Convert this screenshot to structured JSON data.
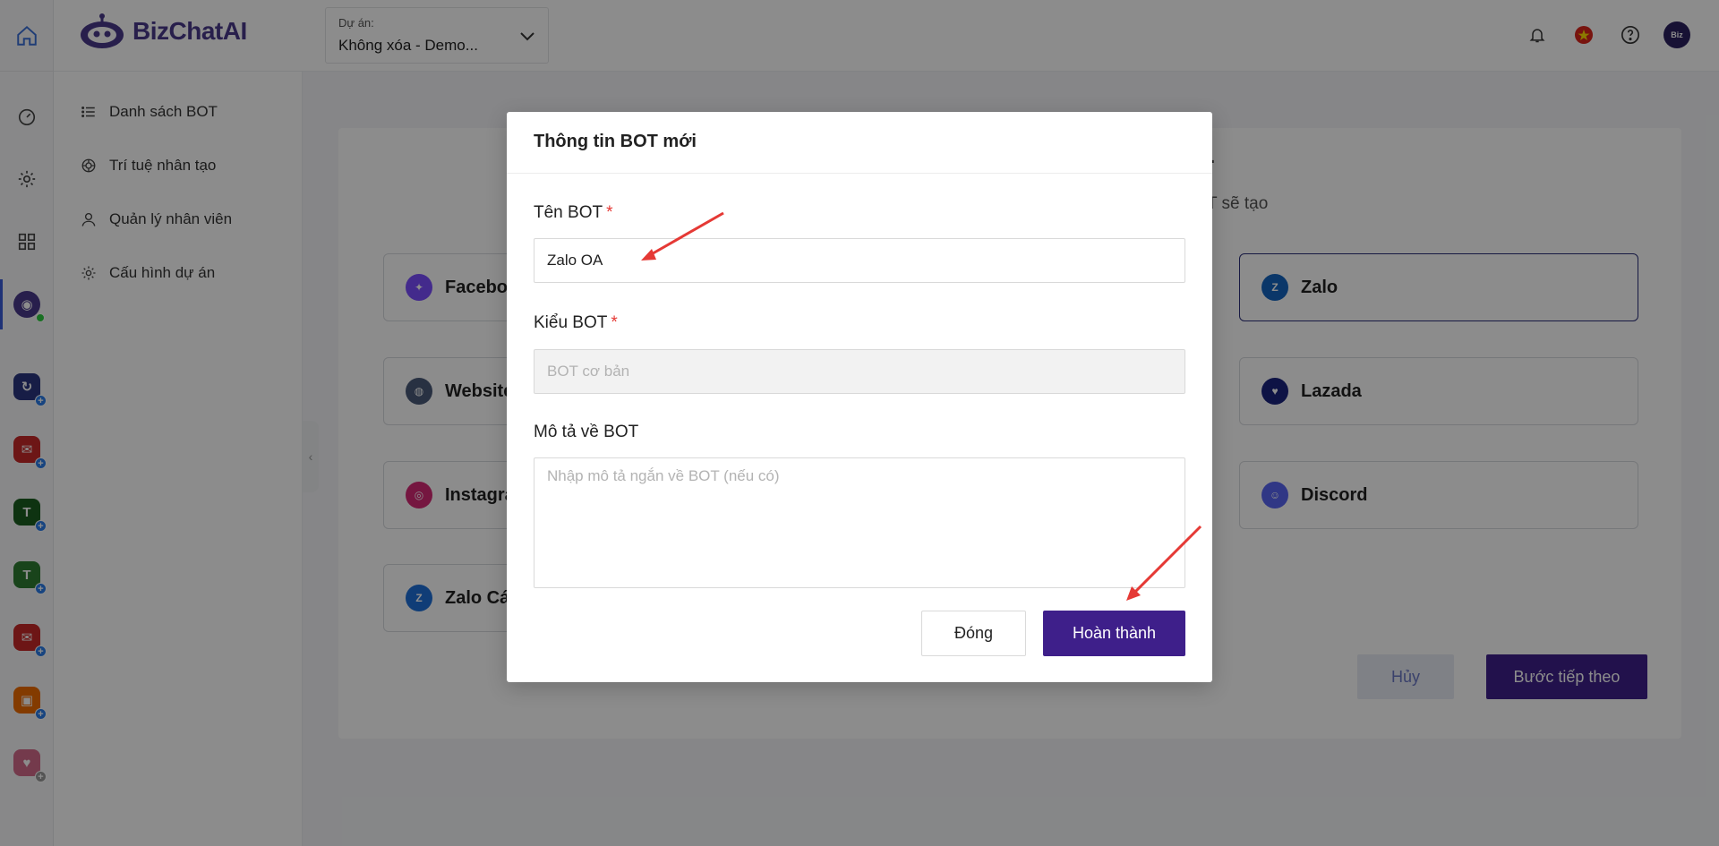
{
  "header": {
    "logo_text": "BizChatAI",
    "project_label": "Dự án:",
    "project_value": "Không xóa - Demo...",
    "icons": [
      "bell-icon",
      "vietnam-flag-icon",
      "help-icon",
      "user-avatar"
    ]
  },
  "rail": {
    "icons": [
      "home-icon",
      "dashboard-icon",
      "settings-icon",
      "apps-grid-icon",
      "bizchat-app-icon",
      "app-1-icon",
      "app-2-icon",
      "app-3-icon",
      "app-4-icon",
      "app-5-icon",
      "app-6-icon",
      "app-7-icon"
    ]
  },
  "sidebar": {
    "items": [
      {
        "label": "Danh sách BOT",
        "icon": "list-icon"
      },
      {
        "label": "Trí tuệ nhân tạo",
        "icon": "openai-icon"
      },
      {
        "label": "Quản lý nhân viên",
        "icon": "user-icon"
      },
      {
        "label": "Cấu hình dự án",
        "icon": "gear-icon"
      }
    ]
  },
  "background_panel": {
    "title_partial": "-",
    "subtitle_partial": "T sẽ tạo",
    "cards": [
      {
        "label": "Faceboo",
        "icon": "messenger-icon",
        "color": "#7b4dff"
      },
      {
        "label": "Zalo",
        "icon": "zalo-icon",
        "color": "#1565c0"
      },
      {
        "label": "Website",
        "icon": "website-icon",
        "color": "#4a5a78"
      },
      {
        "label": "Lazada",
        "icon": "lazada-icon",
        "color": "#1a237e"
      },
      {
        "label": "Instagra",
        "icon": "instagram-icon",
        "color": "#d62976"
      },
      {
        "label": "Discord",
        "icon": "discord-icon",
        "color": "#5865f2"
      },
      {
        "label": "Zalo Cá",
        "icon": "zalo-personal-icon",
        "color": "#1e6fd9"
      }
    ],
    "cancel_label": "Hủy",
    "next_label": "Bước tiếp theo"
  },
  "modal": {
    "title": "Thông tin BOT mới",
    "name_label": "Tên BOT",
    "name_value": "Zalo OA",
    "type_label": "Kiểu BOT",
    "type_placeholder": "BOT cơ bản",
    "desc_label": "Mô tả về BOT",
    "desc_placeholder": "Nhập mô tả ngắn về BOT (nếu có)",
    "required_mark": "*",
    "close_label": "Đóng",
    "done_label": "Hoàn thành"
  },
  "colors": {
    "primary": "#3e1f8a",
    "required": "#e53935",
    "annotation_arrow": "#e53935"
  }
}
